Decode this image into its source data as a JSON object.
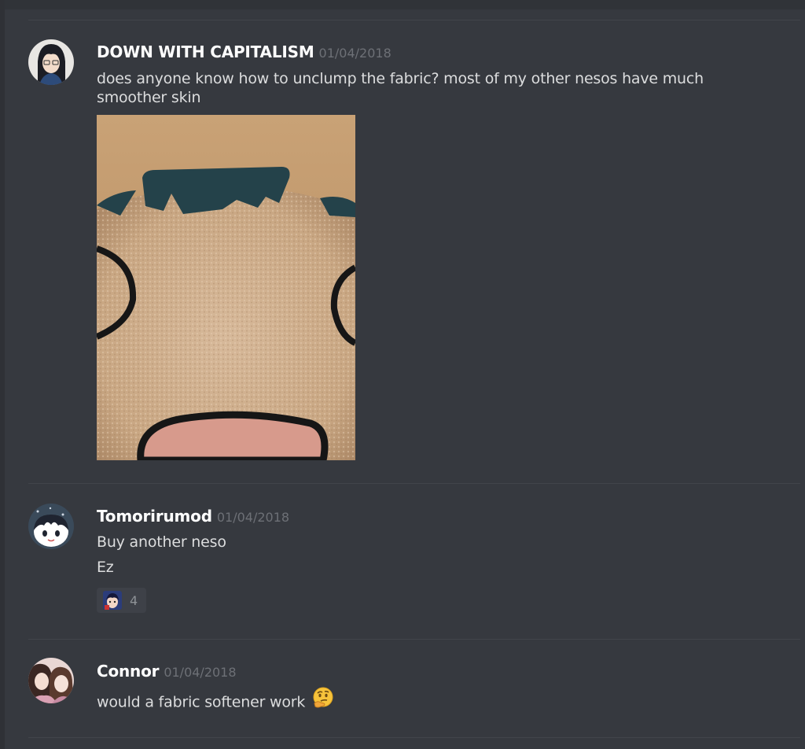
{
  "messages": [
    {
      "username": "DOWN WITH CAPITALISM",
      "timestamp": "01/04/2018",
      "lines": [
        "does anyone know how to unclump the fabric? most of my other nesos have much",
        "smoother skin"
      ],
      "avatar": "anime-girl-glasses-avatar",
      "attachment": "plush-doll-face-photo"
    },
    {
      "username": "Tomorirumod",
      "timestamp": "01/04/2018",
      "lines": [
        "Buy another neso",
        "Ez"
      ],
      "avatar": "anime-chibi-avatar",
      "reaction": {
        "emoji": "custom-anime-emoji",
        "count": "4"
      }
    },
    {
      "username": "Connor",
      "timestamp": "01/04/2018",
      "text": "would a fabric softener work",
      "avatar": "two-people-photo-avatar",
      "emoji": "thinking-face-emoji"
    }
  ],
  "colors": {
    "background": "#36393f",
    "username": "#ffffff",
    "timestamp": "#6d7076",
    "message_text": "#dcddde",
    "divider": "#42454b",
    "reaction_bg": "#3e4148"
  }
}
